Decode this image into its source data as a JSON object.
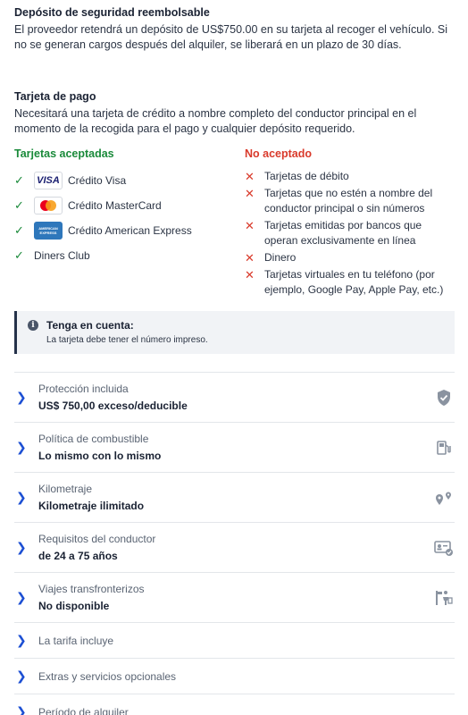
{
  "deposit": {
    "title": "Depósito de seguridad reembolsable",
    "text": "El proveedor retendrá un depósito de US$750.00 en su tarjeta al recoger el vehículo. Si no se generan cargos después del alquiler, se liberará en un plazo de 30 días."
  },
  "payment": {
    "title": "Tarjeta de pago",
    "text": "Necesitará una tarjeta de crédito a nombre completo del conductor principal en el momento de la recogida para el pago y cualquier depósito requerido."
  },
  "accepted": {
    "heading": "Tarjetas aceptadas",
    "items": [
      {
        "label": "Crédito Visa",
        "icon": "visa-logo"
      },
      {
        "label": "Crédito MasterCard",
        "icon": "mastercard-logo"
      },
      {
        "label": "Crédito American Express",
        "icon": "amex-logo"
      },
      {
        "label": "Diners Club",
        "icon": ""
      }
    ],
    "visa_text": "VISA",
    "amex_text": "AMERICAN EXPRESS"
  },
  "rejected": {
    "heading": "No aceptado",
    "items": [
      "Tarjetas de débito",
      "Tarjetas que no estén a nombre del conductor principal o sin números",
      "Tarjetas emitidas por bancos que operan exclusivamente en línea",
      "Dinero",
      "Tarjetas virtuales en tu teléfono (por ejemplo, Google Pay, Apple Pay, etc.)"
    ]
  },
  "note": {
    "title": "Tenga en cuenta:",
    "text": "La tarjeta debe tener el número impreso."
  },
  "accordion": [
    {
      "label": "Protección incluida",
      "value": "US$ 750,00 exceso/deducible",
      "icon": "shield-check-icon"
    },
    {
      "label": "Política de combustible",
      "value": "Lo mismo con lo mismo",
      "icon": "fuel-pump-icon"
    },
    {
      "label": "Kilometraje",
      "value": "Kilometraje ilimitado",
      "icon": "route-pins-icon"
    },
    {
      "label": "Requisitos del conductor",
      "value": "de 24 a 75 años",
      "icon": "id-card-icon"
    },
    {
      "label": "Viajes transfronterizos",
      "value": "No disponible",
      "icon": "border-person-icon"
    },
    {
      "label": "La tarifa incluye"
    },
    {
      "label": "Extras y servicios opcionales"
    },
    {
      "label": "Período de alquiler"
    }
  ],
  "colors": {
    "accepted": "#1a8a3a",
    "rejected": "#d93a2b",
    "chevron": "#1c4fd3",
    "icon_gray": "#8a93a0"
  }
}
